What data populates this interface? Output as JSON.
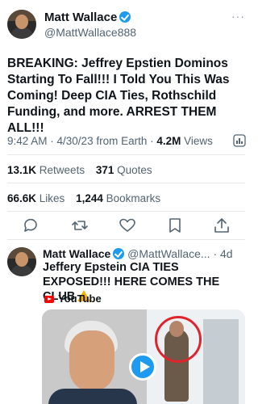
{
  "tweet": {
    "author_name": "Matt Wallace",
    "author_handle": "@MattWallace888",
    "more": "···",
    "text": "BREAKING: Jeffrey Epstien Dominos Starting To Fall!!! I Told You This Was Coming! Deep CIA Ties, Rothschild Funding, and more. ARREST THEM ALL!!!",
    "time": "9:42 AM",
    "date": "4/30/23",
    "source": "from Earth",
    "views_count": "4.2M",
    "views_label": "Views",
    "retweets_count": "13.1K",
    "retweets_label": "Retweets",
    "quotes_count": "371",
    "quotes_label": "Quotes",
    "likes_count": "66.6K",
    "likes_label": "Likes",
    "bookmarks_count": "1,244",
    "bookmarks_label": "Bookmarks"
  },
  "quoted": {
    "author_name": "Matt Wallace",
    "author_handle": "@MattWallace...",
    "age": "4d",
    "text": "Jeffery Epstein CIA TIES EXPOSED!!! HERE COMES THE CLUB",
    "source_label": "YouTube"
  },
  "colors": {
    "verified": "#1d9bf0",
    "secondary_text": "#536471",
    "youtube_red": "#ff0000",
    "warning": "#f4b400",
    "circle": "#e0242c"
  },
  "icons": [
    "verified-badge-icon",
    "more-icon",
    "views-analytics-icon",
    "reply-icon",
    "retweet-icon",
    "like-icon",
    "bookmark-icon",
    "share-icon",
    "warning-icon",
    "youtube-icon",
    "play-icon"
  ]
}
